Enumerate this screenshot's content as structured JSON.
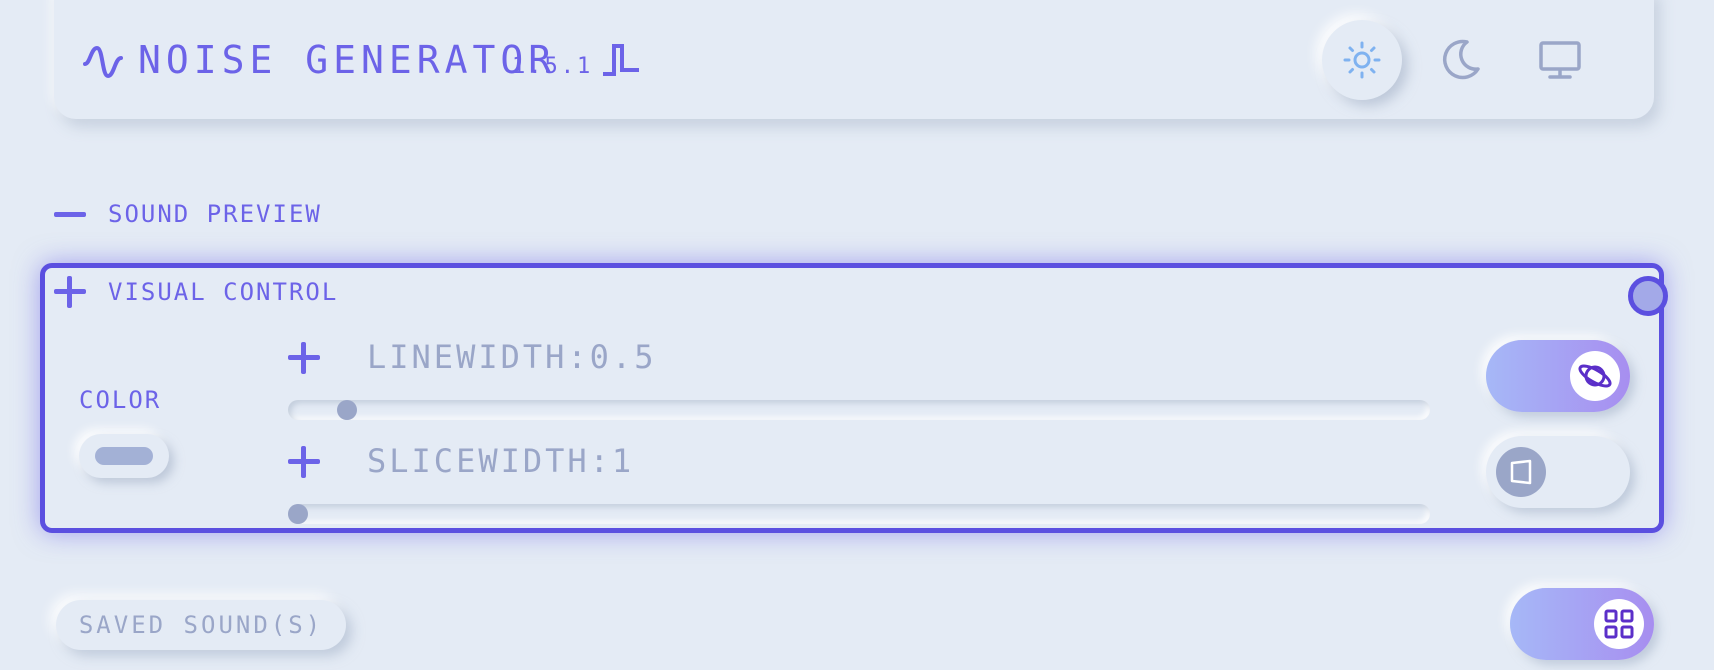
{
  "header": {
    "title": "NOISE GENERATOR",
    "version": "1.5.1",
    "icons": [
      "sine-wave-icon",
      "square-wave-icon"
    ],
    "theme_buttons": [
      {
        "icon": "sun-icon",
        "selected": true
      },
      {
        "icon": "moon-icon",
        "selected": false
      },
      {
        "icon": "monitor-icon",
        "selected": false
      }
    ]
  },
  "sections": {
    "sound_preview": {
      "label": "SOUND PREVIEW",
      "expanded": false
    },
    "visual_control": {
      "label": "VISUAL CONTROL",
      "expanded": true
    }
  },
  "visual_control": {
    "color_label": "COLOR",
    "linewidth": {
      "label": "LINEWIDTH:0.5",
      "value": 0.5,
      "fraction": 0.044
    },
    "slicewidth": {
      "label": "SLICEWIDTH:1",
      "value": 1,
      "fraction": 0.0
    },
    "toggles": [
      {
        "icon": "planet-icon",
        "on": true
      },
      {
        "icon": "square-icon",
        "on": false
      }
    ]
  },
  "footer": {
    "saved_sounds_label": "SAVED SOUND(S)",
    "grid_toggle": {
      "icon": "grid-icon",
      "on": true
    }
  },
  "colors": {
    "accent": "#6c63e8",
    "border": "#5b4fe0",
    "background": "#e4ebf5",
    "muted": "#9aa6c8",
    "sun": "#7fb2f0"
  }
}
